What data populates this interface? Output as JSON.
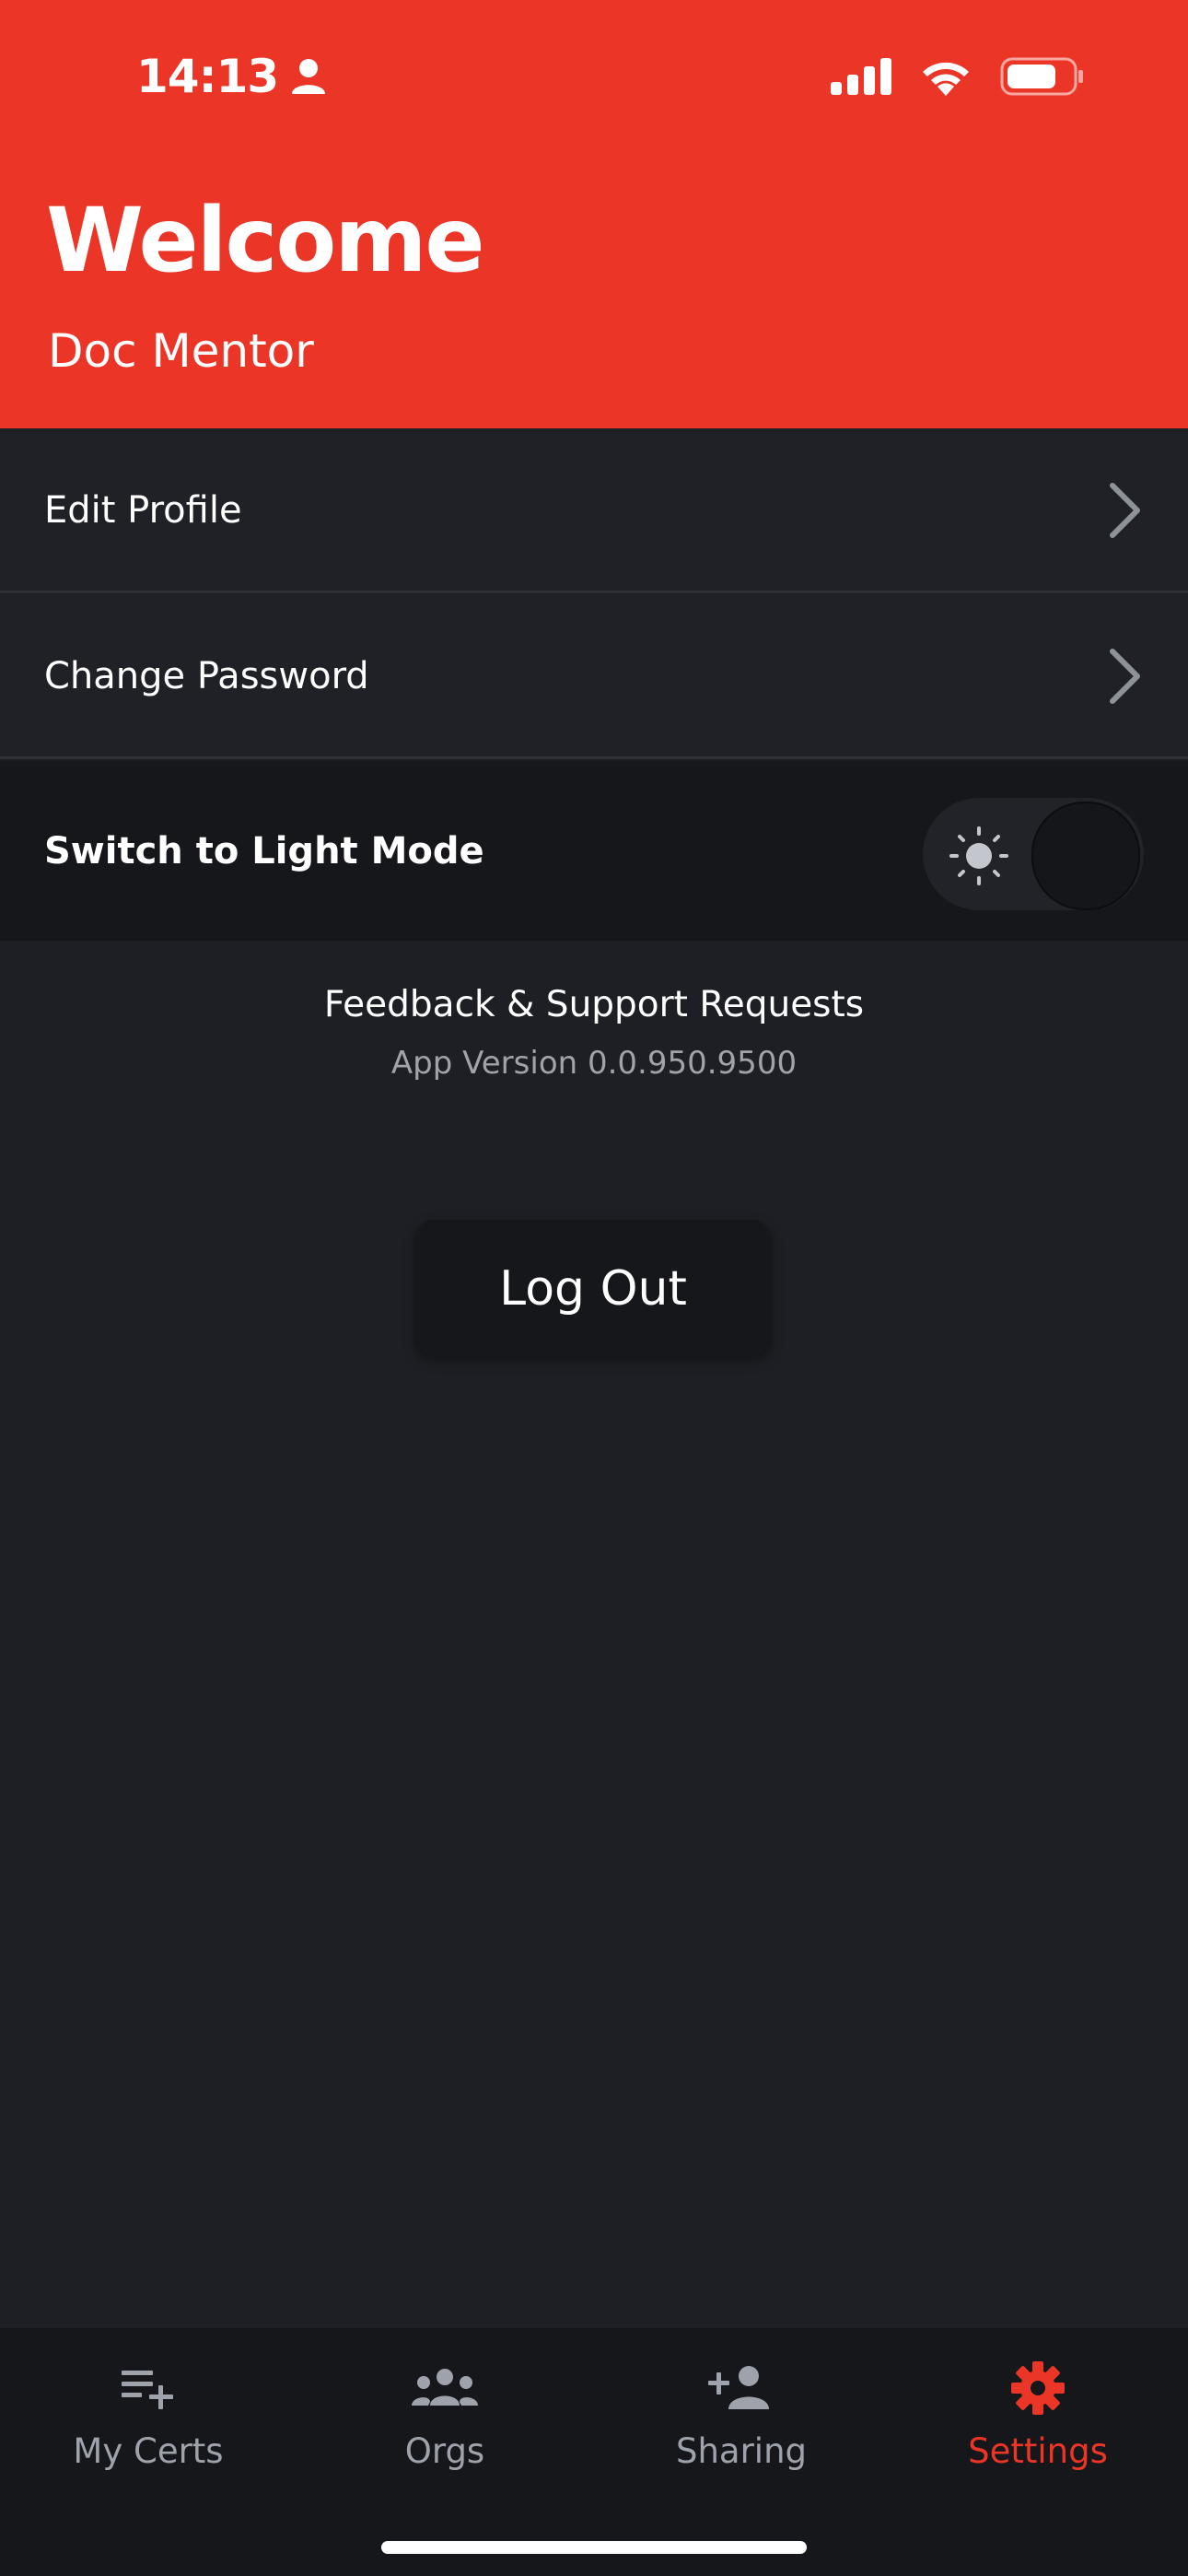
{
  "status_bar": {
    "time": "14:13"
  },
  "header": {
    "title": "Welcome",
    "username": "Doc Mentor"
  },
  "menu": {
    "edit_profile": "Edit Profile",
    "change_password": "Change Password"
  },
  "appearance": {
    "toggle_label": "Switch to Light Mode",
    "light_mode_enabled": false
  },
  "support": {
    "feedback_label": "Feedback & Support Requests",
    "app_version": "App Version 0.0.950.9500"
  },
  "logout_label": "Log Out",
  "tabbar": {
    "tabs": [
      {
        "label": "My Certs",
        "icon": "playlist-add-icon"
      },
      {
        "label": "Orgs",
        "icon": "group-icon"
      },
      {
        "label": "Sharing",
        "icon": "person-add-icon"
      },
      {
        "label": "Settings",
        "icon": "gear-icon",
        "active": true
      }
    ]
  },
  "colors": {
    "accent": "#eb3526",
    "background": "#1d1f24",
    "surface": "#16171b"
  }
}
